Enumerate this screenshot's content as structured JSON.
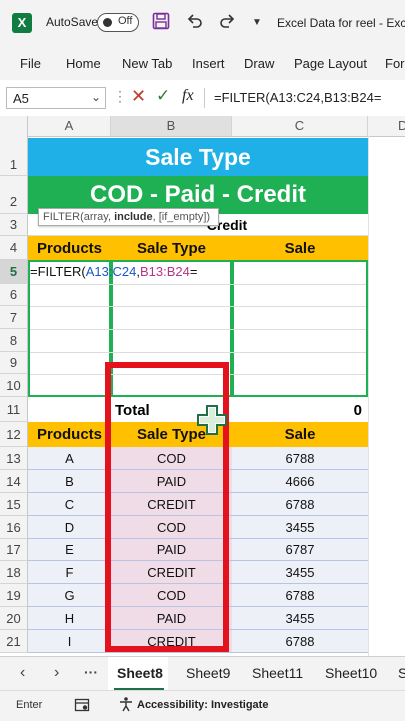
{
  "titlebar": {
    "app_logo": "X",
    "autosave_label": "AutoSave",
    "autosave_state": "Off",
    "doc_title": "Excel Data for reel  -  Exc"
  },
  "ribbon": {
    "menus": [
      "File",
      "Home",
      "New Tab",
      "Insert",
      "Draw",
      "Page Layout",
      "For"
    ]
  },
  "formula_bar": {
    "name_box": "A5",
    "formula": "=FILTER(A13:C24,B13:B24="
  },
  "grid": {
    "columns": [
      "A",
      "B",
      "C",
      "D"
    ],
    "rows": [
      "1",
      "2",
      "3",
      "4",
      "5",
      "6",
      "7",
      "8",
      "9",
      "10",
      "11",
      "12",
      "13",
      "14",
      "15",
      "16",
      "17",
      "18",
      "19",
      "20",
      "21"
    ],
    "title1": "Sale Type",
    "title2": "COD - Paid - Credit",
    "row3_text": "Credit",
    "headers": [
      "Products",
      "Sale Type",
      "Sale"
    ],
    "editing_cell": {
      "prefix": "=FILTER(",
      "ref1": "A13:C24",
      "sep": ",",
      "ref2": "B13:B24",
      "suffix": "="
    },
    "tooltip": {
      "prefix": "FILTER(array, ",
      "bold": "include",
      "suffix": ", [if_empty])"
    },
    "total_label": "Total",
    "total_value": "0",
    "data": [
      [
        "A",
        "COD",
        "6788"
      ],
      [
        "B",
        "PAID",
        "4666"
      ],
      [
        "C",
        "CREDIT",
        "6788"
      ],
      [
        "D",
        "COD",
        "3455"
      ],
      [
        "E",
        "PAID",
        "6787"
      ],
      [
        "F",
        "CREDIT",
        "3455"
      ],
      [
        "G",
        "COD",
        "6788"
      ],
      [
        "H",
        "PAID",
        "3455"
      ],
      [
        "I",
        "CREDIT",
        "6788"
      ]
    ]
  },
  "sheet_tabs": {
    "tabs": [
      "Sheet8",
      "Sheet9",
      "Sheet11",
      "Sheet10",
      "S"
    ],
    "active_index": 0
  },
  "status_bar": {
    "mode": "Enter",
    "accessibility": "Accessibility: Investigate"
  },
  "colors": {
    "excel_green": "#107c41",
    "title_blue": "#1fb0e8",
    "title_green": "#1eb052",
    "header_gold": "#ffc000",
    "highlight_red": "#e3121d"
  }
}
